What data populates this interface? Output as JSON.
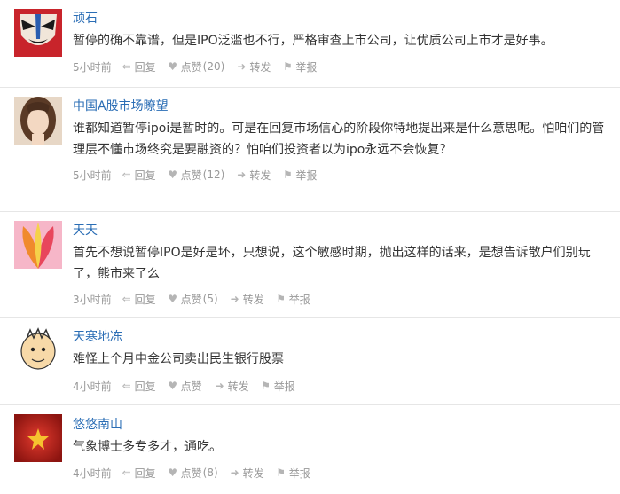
{
  "actions": {
    "reply": "回复",
    "like": "点赞",
    "forward": "转发",
    "report": "举报"
  },
  "comments": [
    {
      "user": "顽石",
      "text": "暂停的确不靠谱，但是IPO泛滥也不行，严格审查上市公司，让优质公司上市才是好事。",
      "time": "5小时前",
      "likes": "(20)"
    },
    {
      "user": "中国A股市场瞭望",
      "text": "谁都知道暂停ipoi是暂时的。可是在回复市场信心的阶段你特地提出来是什么意思呢。怕咱们的管理层不懂市场终究是要融资的？怕咱们投资者以为ipo永远不会恢复？",
      "time": "5小时前",
      "likes": "(12)"
    },
    {
      "user": "天天",
      "text": "首先不想说暂停IPO是好是坏，只想说，这个敏感时期，抛出这样的话来，是想告诉散户们别玩了，熊市来了么",
      "time": "3小时前",
      "likes": "(5)"
    },
    {
      "user": "天寒地冻",
      "text": "难怪上个月中金公司卖出民生银行股票",
      "time": "4小时前",
      "likes": ""
    },
    {
      "user": "悠悠南山",
      "text": "气象博士多专多才，通吃。",
      "time": "4小时前",
      "likes": "(8)"
    }
  ]
}
